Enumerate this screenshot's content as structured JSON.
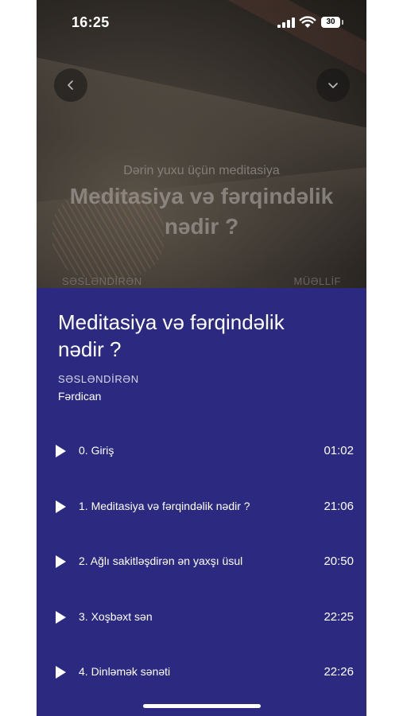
{
  "status_bar": {
    "time": "16:25",
    "battery": "30"
  },
  "hero": {
    "subtitle": "Dərin yuxu üçün meditasiya",
    "title": "Meditasiya və fərqindəlik nədir ?",
    "label_left": "SƏSLƏNDİRƏN",
    "label_right": "MÜƏLLİF"
  },
  "content": {
    "title": "Meditasiya və fərqindəlik nədir ?",
    "narrator_label": "SƏSLƏNDİRƏN",
    "narrator_name": "Fərdican"
  },
  "tracks": [
    {
      "name": "0. Giriş",
      "duration": "01:02"
    },
    {
      "name": "1. Meditasiya və fərqindəlik nədir ?",
      "duration": "21:06"
    },
    {
      "name": "2. Ağlı sakitləşdirən ən yaxşı üsul",
      "duration": "20:50"
    },
    {
      "name": "3. Xoşbəxt sən",
      "duration": "22:25"
    },
    {
      "name": "4. Dinləmək sənəti",
      "duration": "22:26"
    }
  ],
  "icons": {
    "back": "chevron-left-icon",
    "collapse": "chevron-down-icon",
    "play": "play-icon",
    "signal": "cellular-signal-icon",
    "wifi": "wifi-icon",
    "battery": "battery-icon"
  },
  "colors": {
    "sheet_background": "#2b2a80",
    "text": "#ffffff"
  }
}
